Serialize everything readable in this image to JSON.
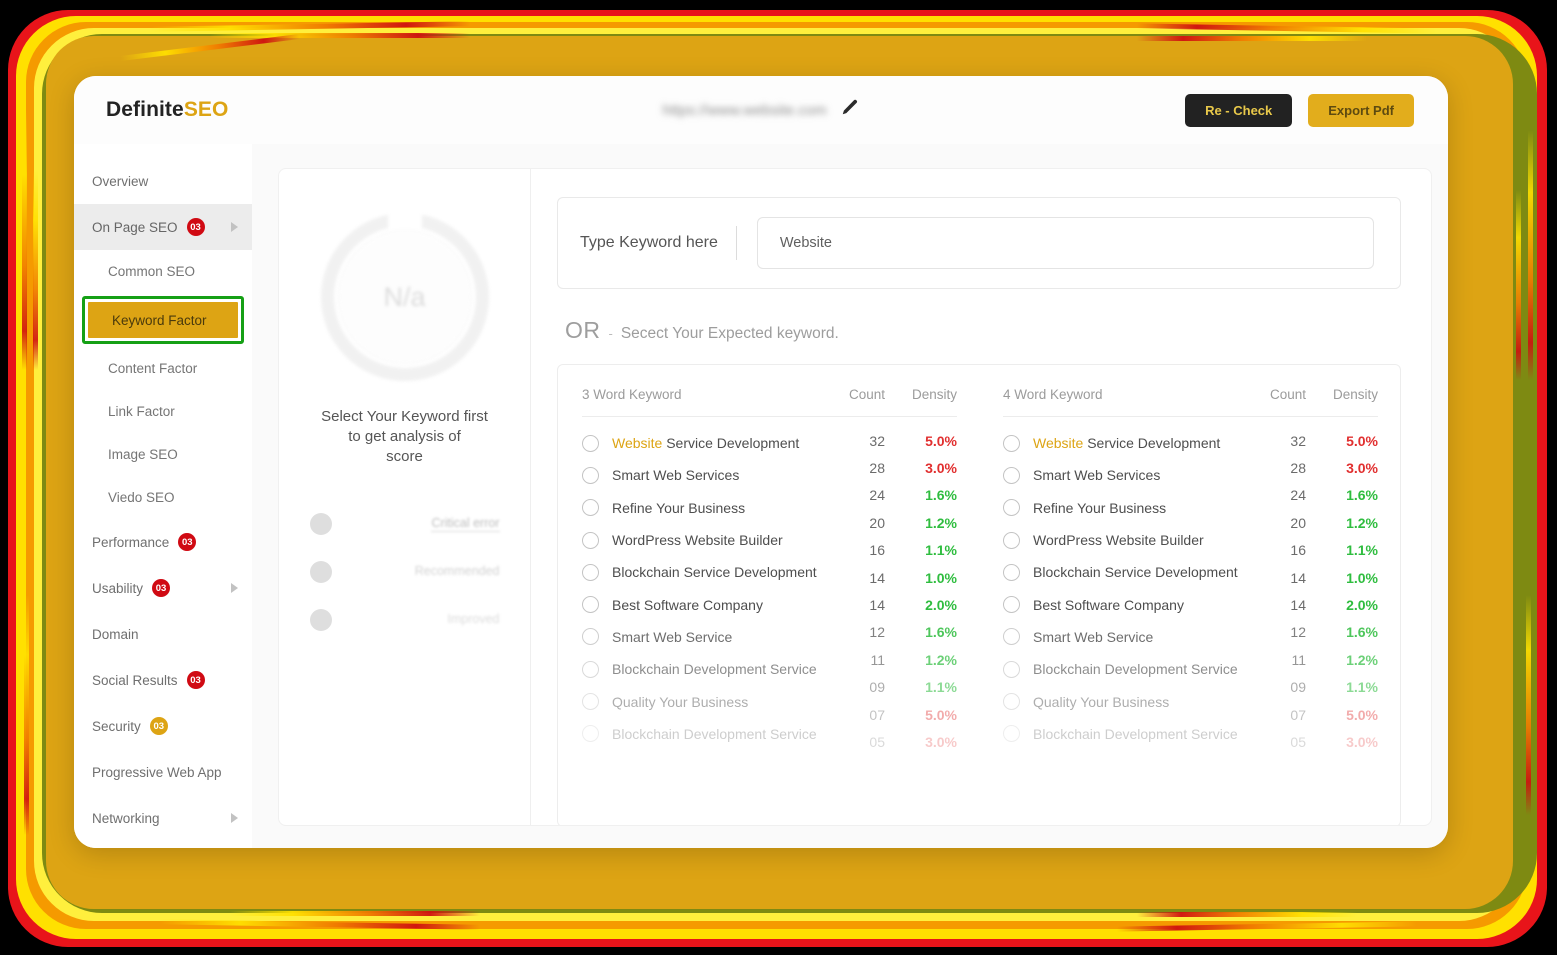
{
  "brand": {
    "text_main": "Definite",
    "text_accent": "SEO"
  },
  "topbar": {
    "site_url": "https://www.website.com",
    "edit_icon": "pencil-icon",
    "recheck_label": "Re - Check",
    "export_label": "Export Pdf",
    "recheck_bg": "#222222",
    "recheck_fg": "#e8c84a",
    "export_bg": "#e2ad1c",
    "export_fg": "#5d4a10"
  },
  "sidebar": {
    "items": [
      {
        "label": "Overview",
        "badge": null,
        "caret": false,
        "sub": false,
        "shaded": false
      },
      {
        "label": "On Page SEO",
        "badge": "03",
        "caret": true,
        "sub": false,
        "shaded": true
      },
      {
        "label": "Common SEO",
        "badge": null,
        "caret": false,
        "sub": true,
        "shaded": false
      },
      {
        "label": "Keyword Factor",
        "badge": null,
        "caret": false,
        "sub": true,
        "shaded": false,
        "selected": true
      },
      {
        "label": "Content Factor",
        "badge": null,
        "caret": false,
        "sub": true,
        "shaded": false
      },
      {
        "label": "Link Factor",
        "badge": null,
        "caret": false,
        "sub": true,
        "shaded": false
      },
      {
        "label": "Image SEO",
        "badge": null,
        "caret": false,
        "sub": true,
        "shaded": false
      },
      {
        "label": "Viedo SEO",
        "badge": null,
        "caret": false,
        "sub": true,
        "shaded": false
      },
      {
        "label": "Performance",
        "badge": "03",
        "caret": false,
        "sub": false,
        "shaded": false
      },
      {
        "label": "Usability",
        "badge": "03",
        "caret": true,
        "sub": false,
        "shaded": false
      },
      {
        "label": "Domain",
        "badge": null,
        "caret": false,
        "sub": false,
        "shaded": false
      },
      {
        "label": "Social Results",
        "badge": "03",
        "caret": false,
        "sub": false,
        "shaded": false
      },
      {
        "label": "Security",
        "badge": "03",
        "badge_color": "gold",
        "caret": false,
        "sub": false,
        "shaded": false
      },
      {
        "label": "Progressive Web App",
        "badge": null,
        "caret": false,
        "sub": false,
        "shaded": false
      },
      {
        "label": "Networking",
        "badge": null,
        "caret": true,
        "sub": false,
        "shaded": false
      }
    ],
    "selected_label": "Keyword Factor",
    "selected_highlight_color": "#15a015",
    "selected_bg": "#dda414",
    "badge_color": "#d00a13",
    "badge_gold_color": "#dda414"
  },
  "score": {
    "gauge_value": "N/a",
    "hint_line1": "Select Your Keyword first",
    "hint_line2": "to get analysis of",
    "hint_line3": "score",
    "legend": [
      {
        "title": "Critical error",
        "sub": ""
      },
      {
        "title": "Recommended",
        "sub": ""
      },
      {
        "title": "Improved",
        "sub": ""
      }
    ]
  },
  "keyword_input": {
    "label": "Type Keyword here",
    "value": "Website",
    "placeholder": "Website"
  },
  "or_section": {
    "or": "OR",
    "dash": "-",
    "text": "Secect Your Expected keyword."
  },
  "tables": [
    {
      "name_header": "3 Word Keyword",
      "count_header": "Count",
      "density_header": "Density",
      "rows": [
        {
          "highlight": "Website",
          "rest": " Service Development"
        },
        {
          "highlight": "",
          "rest": "Smart Web Services"
        },
        {
          "highlight": "",
          "rest": "Refine Your Business"
        },
        {
          "highlight": "",
          "rest": "WordPress Website Builder"
        },
        {
          "highlight": "",
          "rest": "Blockchain Service Development"
        },
        {
          "highlight": "",
          "rest": "Best Software Company"
        },
        {
          "highlight": "",
          "rest": "Smart Web Service"
        },
        {
          "highlight": "",
          "rest": "Blockchain Development Service"
        },
        {
          "highlight": "",
          "rest": "Quality Your Business"
        },
        {
          "highlight": "",
          "rest": "Blockchain Development Service"
        }
      ],
      "values": [
        {
          "count": "32",
          "density": "5.0%",
          "tone": "red"
        },
        {
          "count": "28",
          "density": "3.0%",
          "tone": "red"
        },
        {
          "count": "24",
          "density": "1.6%",
          "tone": "green"
        },
        {
          "count": "20",
          "density": "1.2%",
          "tone": "green"
        },
        {
          "count": "16",
          "density": "1.1%",
          "tone": "green"
        },
        {
          "count": "14",
          "density": "1.0%",
          "tone": "green"
        },
        {
          "count": "14",
          "density": "2.0%",
          "tone": "green"
        },
        {
          "count": "12",
          "density": "1.6%",
          "tone": "green"
        },
        {
          "count": "11",
          "density": "1.2%",
          "tone": "green"
        },
        {
          "count": "09",
          "density": "1.1%",
          "tone": "green"
        },
        {
          "count": "07",
          "density": "5.0%",
          "tone": "red"
        },
        {
          "count": "05",
          "density": "3.0%",
          "tone": "red"
        }
      ]
    },
    {
      "name_header": "4 Word Keyword",
      "count_header": "Count",
      "density_header": "Density",
      "rows": [
        {
          "highlight": "Website",
          "rest": " Service Development"
        },
        {
          "highlight": "",
          "rest": "Smart Web Services"
        },
        {
          "highlight": "",
          "rest": "Refine Your Business"
        },
        {
          "highlight": "",
          "rest": "WordPress Website Builder"
        },
        {
          "highlight": "",
          "rest": "Blockchain Service Development"
        },
        {
          "highlight": "",
          "rest": "Best Software Company"
        },
        {
          "highlight": "",
          "rest": "Smart Web Service"
        },
        {
          "highlight": "",
          "rest": "Blockchain Development Service"
        },
        {
          "highlight": "",
          "rest": "Quality Your Business"
        },
        {
          "highlight": "",
          "rest": "Blockchain Development Service"
        }
      ],
      "values": [
        {
          "count": "32",
          "density": "5.0%",
          "tone": "red"
        },
        {
          "count": "28",
          "density": "3.0%",
          "tone": "red"
        },
        {
          "count": "24",
          "density": "1.6%",
          "tone": "green"
        },
        {
          "count": "20",
          "density": "1.2%",
          "tone": "green"
        },
        {
          "count": "16",
          "density": "1.1%",
          "tone": "green"
        },
        {
          "count": "14",
          "density": "1.0%",
          "tone": "green"
        },
        {
          "count": "14",
          "density": "2.0%",
          "tone": "green"
        },
        {
          "count": "12",
          "density": "1.6%",
          "tone": "green"
        },
        {
          "count": "11",
          "density": "1.2%",
          "tone": "green"
        },
        {
          "count": "09",
          "density": "1.1%",
          "tone": "green"
        },
        {
          "count": "07",
          "density": "5.0%",
          "tone": "red"
        },
        {
          "count": "05",
          "density": "3.0%",
          "tone": "red"
        }
      ]
    }
  ]
}
